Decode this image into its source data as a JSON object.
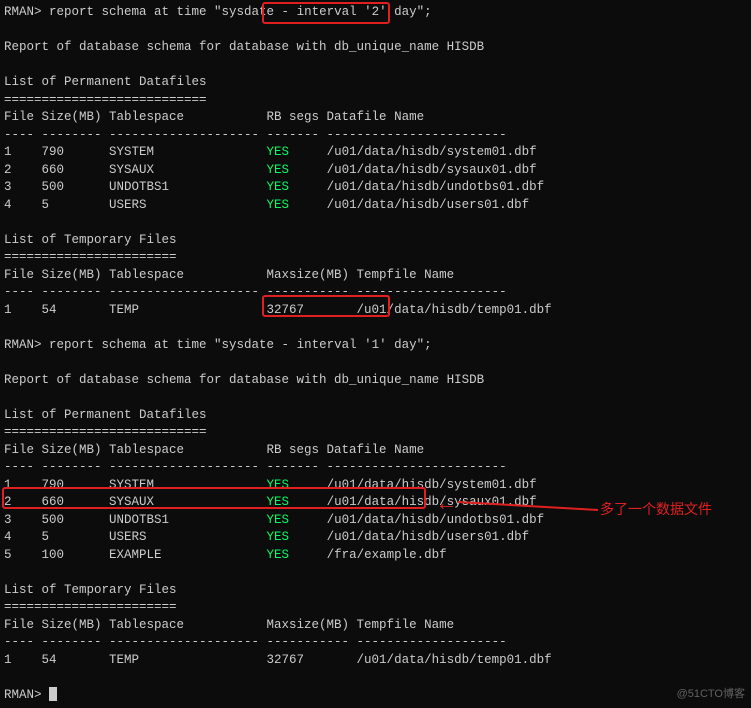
{
  "block1": {
    "prompt": "RMAN> ",
    "cmd_pre": "report schema at time \"sysdate - ",
    "cmd_box": "interval '2' day",
    "cmd_post": "\";",
    "report_title": "Report of database schema for database with db_unique_name HISDB",
    "perm_header": "List of Permanent Datafiles",
    "perm_sep": "===========================",
    "perm_cols": "File Size(MB) Tablespace           RB segs Datafile Name",
    "perm_dash": "---- -------- -------------------- ------- ------------------------",
    "perm_rows": [
      {
        "file": "1",
        "size": "790",
        "ts": "SYSTEM",
        "rb": "YES",
        "path": "/u01/data/hisdb/system01.dbf"
      },
      {
        "file": "2",
        "size": "660",
        "ts": "SYSAUX",
        "rb": "YES",
        "path": "/u01/data/hisdb/sysaux01.dbf"
      },
      {
        "file": "3",
        "size": "500",
        "ts": "UNDOTBS1",
        "rb": "YES",
        "path": "/u01/data/hisdb/undotbs01.dbf"
      },
      {
        "file": "4",
        "size": "5",
        "ts": "USERS",
        "rb": "YES",
        "path": "/u01/data/hisdb/users01.dbf"
      }
    ],
    "temp_header": "List of Temporary Files",
    "temp_sep": "=======================",
    "temp_cols": "File Size(MB) Tablespace           Maxsize(MB) Tempfile Name",
    "temp_dash": "---- -------- -------------------- ----------- --------------------",
    "temp_rows": [
      {
        "file": "1",
        "size": "54",
        "ts": "TEMP",
        "max": "32767",
        "path": "/u01/data/hisdb/temp01.dbf"
      }
    ]
  },
  "block2": {
    "prompt": "RMAN> ",
    "cmd_pre": "report schema at time \"sysdate - ",
    "cmd_box": "interval '1' day",
    "cmd_post": "\";",
    "report_title": "Report of database schema for database with db_unique_name HISDB",
    "perm_header": "List of Permanent Datafiles",
    "perm_sep": "===========================",
    "perm_cols": "File Size(MB) Tablespace           RB segs Datafile Name",
    "perm_dash": "---- -------- -------------------- ------- ------------------------",
    "perm_rows": [
      {
        "file": "1",
        "size": "790",
        "ts": "SYSTEM",
        "rb": "YES",
        "path": "/u01/data/hisdb/system01.dbf"
      },
      {
        "file": "2",
        "size": "660",
        "ts": "SYSAUX",
        "rb": "YES",
        "path": "/u01/data/hisdb/sysaux01.dbf"
      },
      {
        "file": "3",
        "size": "500",
        "ts": "UNDOTBS1",
        "rb": "YES",
        "path": "/u01/data/hisdb/undotbs01.dbf"
      },
      {
        "file": "4",
        "size": "5",
        "ts": "USERS",
        "rb": "YES",
        "path": "/u01/data/hisdb/users01.dbf"
      },
      {
        "file": "5",
        "size": "100",
        "ts": "EXAMPLE",
        "rb": "YES",
        "path": "/fra/example.dbf"
      }
    ],
    "temp_header": "List of Temporary Files",
    "temp_sep": "=======================",
    "temp_cols": "File Size(MB) Tablespace           Maxsize(MB) Tempfile Name",
    "temp_dash": "---- -------- -------------------- ----------- --------------------",
    "temp_rows": [
      {
        "file": "1",
        "size": "54",
        "ts": "TEMP",
        "max": "32767",
        "path": "/u01/data/hisdb/temp01.dbf"
      }
    ]
  },
  "final_prompt": "RMAN> ",
  "annotation": "多了一个数据文件",
  "watermark": "@51CTO博客"
}
